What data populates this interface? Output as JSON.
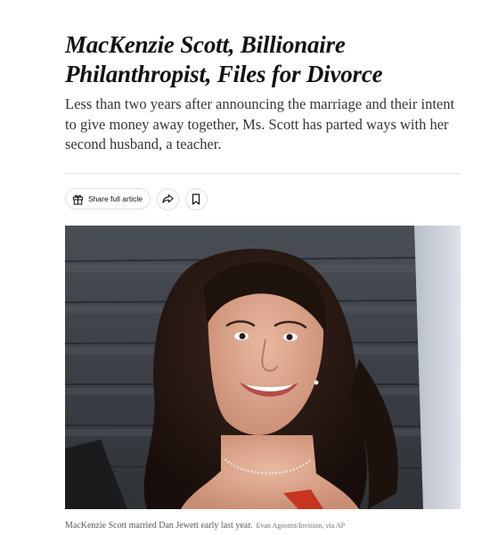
{
  "article": {
    "headline_line1": "MacKenzie Scott, Billionaire",
    "headline_line2": "Philanthropist, Files for Divorce",
    "summary": "Less than two years after announcing the marriage and their intent to give money away together, Ms. Scott has parted ways with her second husband, a teacher."
  },
  "toolbar": {
    "share_full_article_label": "Share full article",
    "icons": {
      "gift": "gift-icon",
      "share": "share-arrow-icon",
      "save": "bookmark-icon"
    }
  },
  "photo": {
    "caption": "MacKenzie Scott married Dan Jewett early last year.",
    "credit": "Evan Agostini/Invision, via AP"
  },
  "colors": {
    "headline": "#121212",
    "summary": "#363636",
    "caption": "#5a5a5a",
    "divider": "#e2e2e2"
  }
}
